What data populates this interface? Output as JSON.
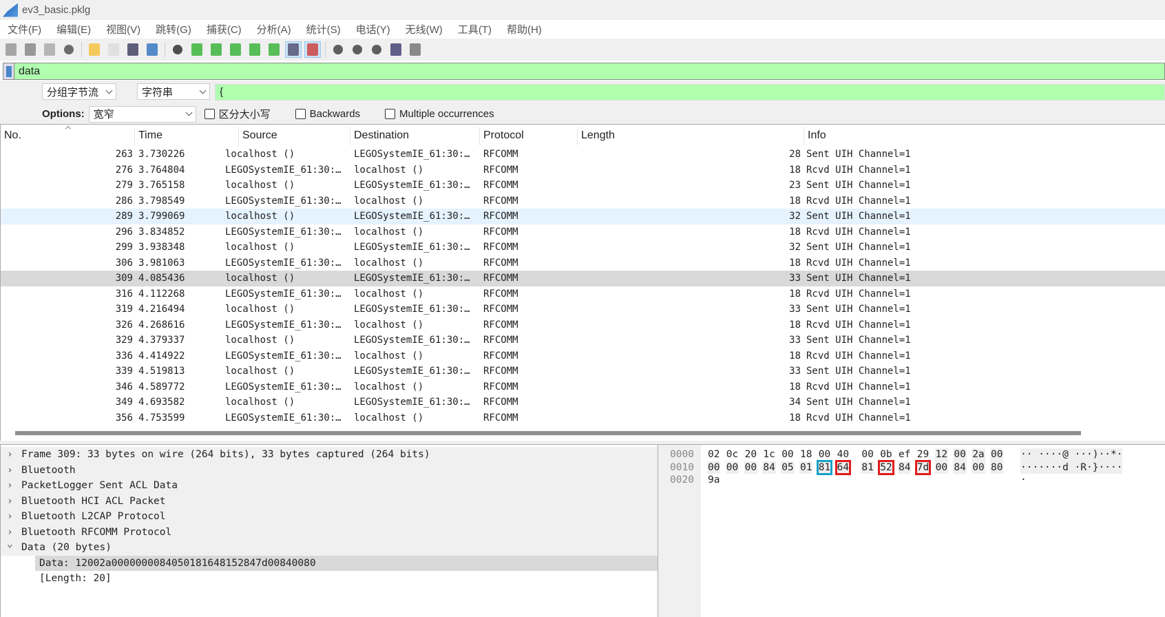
{
  "window": {
    "title": "ev3_basic.pklg"
  },
  "menu": [
    "文件(F)",
    "编辑(E)",
    "视图(V)",
    "跳转(G)",
    "捕获(C)",
    "分析(A)",
    "统计(S)",
    "电话(Y)",
    "无线(W)",
    "工具(T)",
    "帮助(H)"
  ],
  "toolbar": [
    "start-capture",
    "stop-capture",
    "restart-capture",
    "capture-options",
    "open-file",
    "save-file",
    "close-file",
    "reload-file",
    "find-packet",
    "go-back",
    "go-forward",
    "go-to-packet",
    "first-packet",
    "last-packet",
    "auto-scroll",
    "colorize",
    "zoom-in",
    "zoom-out",
    "normal-size",
    "resize-columns",
    "layout"
  ],
  "filter": {
    "value": "data"
  },
  "find": {
    "search_in": "分组字节流",
    "search_type": "字符串",
    "value": "{",
    "options_label": "Options:",
    "charset": "宽窄",
    "case_sensitive": "区分大小写",
    "backwards": "Backwards",
    "multiple": "Multiple occurrences"
  },
  "columns": [
    "No.",
    "Time",
    "Source",
    "Destination",
    "Protocol",
    "Length",
    "Info"
  ],
  "packets": [
    [
      "263",
      "3.730226",
      "localhost ()",
      "LEGOSystemIE_61:30:…",
      "RFCOMM",
      "28",
      "Sent UIH Channel=1"
    ],
    [
      "276",
      "3.764804",
      "LEGOSystemIE_61:30:…",
      "localhost ()",
      "RFCOMM",
      "18",
      "Rcvd UIH Channel=1"
    ],
    [
      "279",
      "3.765158",
      "localhost ()",
      "LEGOSystemIE_61:30:…",
      "RFCOMM",
      "23",
      "Sent UIH Channel=1"
    ],
    [
      "286",
      "3.798549",
      "LEGOSystemIE_61:30:…",
      "localhost ()",
      "RFCOMM",
      "18",
      "Rcvd UIH Channel=1"
    ],
    [
      "289",
      "3.799069",
      "localhost ()",
      "LEGOSystemIE_61:30:…",
      "RFCOMM",
      "32",
      "Sent UIH Channel=1"
    ],
    [
      "296",
      "3.834852",
      "LEGOSystemIE_61:30:…",
      "localhost ()",
      "RFCOMM",
      "18",
      "Rcvd UIH Channel=1"
    ],
    [
      "299",
      "3.938348",
      "localhost ()",
      "LEGOSystemIE_61:30:…",
      "RFCOMM",
      "32",
      "Sent UIH Channel=1"
    ],
    [
      "306",
      "3.981063",
      "LEGOSystemIE_61:30:…",
      "localhost ()",
      "RFCOMM",
      "18",
      "Rcvd UIH Channel=1"
    ],
    [
      "309",
      "4.085436",
      "localhost ()",
      "LEGOSystemIE_61:30:…",
      "RFCOMM",
      "33",
      "Sent UIH Channel=1"
    ],
    [
      "316",
      "4.112268",
      "LEGOSystemIE_61:30:…",
      "localhost ()",
      "RFCOMM",
      "18",
      "Rcvd UIH Channel=1"
    ],
    [
      "319",
      "4.216494",
      "localhost ()",
      "LEGOSystemIE_61:30:…",
      "RFCOMM",
      "33",
      "Sent UIH Channel=1"
    ],
    [
      "326",
      "4.268616",
      "LEGOSystemIE_61:30:…",
      "localhost ()",
      "RFCOMM",
      "18",
      "Rcvd UIH Channel=1"
    ],
    [
      "329",
      "4.379337",
      "localhost ()",
      "LEGOSystemIE_61:30:…",
      "RFCOMM",
      "33",
      "Sent UIH Channel=1"
    ],
    [
      "336",
      "4.414922",
      "LEGOSystemIE_61:30:…",
      "localhost ()",
      "RFCOMM",
      "18",
      "Rcvd UIH Channel=1"
    ],
    [
      "339",
      "4.519813",
      "localhost ()",
      "LEGOSystemIE_61:30:…",
      "RFCOMM",
      "33",
      "Sent UIH Channel=1"
    ],
    [
      "346",
      "4.589772",
      "LEGOSystemIE_61:30:…",
      "localhost ()",
      "RFCOMM",
      "18",
      "Rcvd UIH Channel=1"
    ],
    [
      "349",
      "4.693582",
      "localhost ()",
      "LEGOSystemIE_61:30:…",
      "RFCOMM",
      "34",
      "Sent UIH Channel=1"
    ],
    [
      "356",
      "4.753599",
      "LEGOSystemIE_61:30:…",
      "localhost ()",
      "RFCOMM",
      "18",
      "Rcvd UIH Channel=1"
    ]
  ],
  "hover_packet": "289",
  "selected_packet": "309",
  "details": [
    {
      "text": "Frame 309: 33 bytes on wire (264 bits), 33 bytes captured (264 bits)",
      "expanded": false,
      "level": 0
    },
    {
      "text": "Bluetooth",
      "expanded": false,
      "level": 0
    },
    {
      "text": "PacketLogger Sent ACL Data",
      "expanded": false,
      "level": 0
    },
    {
      "text": "Bluetooth HCI ACL Packet",
      "expanded": false,
      "level": 0
    },
    {
      "text": "Bluetooth L2CAP Protocol",
      "expanded": false,
      "level": 0
    },
    {
      "text": "Bluetooth RFCOMM Protocol",
      "expanded": false,
      "level": 0
    },
    {
      "text": "Data (20 bytes)",
      "expanded": true,
      "level": 0
    },
    {
      "text": "Data: 12002a0000000084050181648152847d00840080",
      "level": 1,
      "selected": true
    },
    {
      "text": "[Length: 20]",
      "level": 1
    }
  ],
  "hex": [
    {
      "offset": "0000",
      "bytes": [
        "02",
        "0c",
        "20",
        "1c",
        "00",
        "18",
        "00",
        "40",
        "00",
        "0b",
        "ef",
        "29",
        "12",
        "00",
        "2a",
        "00"
      ],
      "ascii": "·· ····@ ···)··*·"
    },
    {
      "offset": "0010",
      "bytes": [
        "00",
        "00",
        "00",
        "84",
        "05",
        "01",
        "81",
        "64",
        "81",
        "52",
        "84",
        "7d",
        "00",
        "84",
        "00",
        "80"
      ],
      "ascii": "·······d ·R·}····"
    },
    {
      "offset": "0020",
      "bytes": [
        "9a"
      ],
      "ascii": "·"
    }
  ],
  "hex_highlight": {
    "blue_box_bytes": [
      22
    ],
    "red_box_bytes": [
      23,
      25,
      27
    ],
    "colors": {
      "blue": "#16a2c9",
      "red": "#e31b1b"
    }
  },
  "colors": {
    "filter_bg": "#afffaf",
    "selected_row": "#d9d9d9",
    "hover_row": "#e5f3ff"
  }
}
